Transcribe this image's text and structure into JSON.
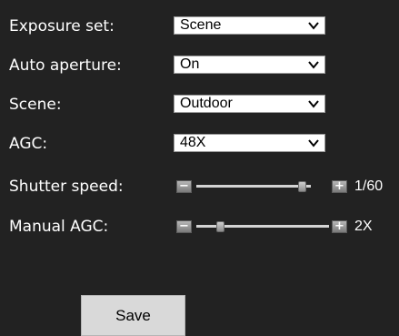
{
  "form": {
    "exposure_set": {
      "label": "Exposure set:",
      "value": "Scene"
    },
    "auto_aperture": {
      "label": "Auto aperture:",
      "value": "On"
    },
    "scene": {
      "label": "Scene:",
      "value": "Outdoor"
    },
    "agc": {
      "label": "AGC:",
      "value": "48X"
    },
    "shutter_speed": {
      "label": "Shutter speed:",
      "value_text": "1/60",
      "minus": "−",
      "plus": "+",
      "level": 0.8
    },
    "manual_agc": {
      "label": "Manual AGC:",
      "value_text": "2X",
      "minus": "−",
      "plus": "+",
      "level": 0.16
    }
  },
  "actions": {
    "save_label": "Save"
  },
  "colors": {
    "background": "#222222",
    "text": "#ffffff",
    "button_face": "#d9d9d9"
  }
}
